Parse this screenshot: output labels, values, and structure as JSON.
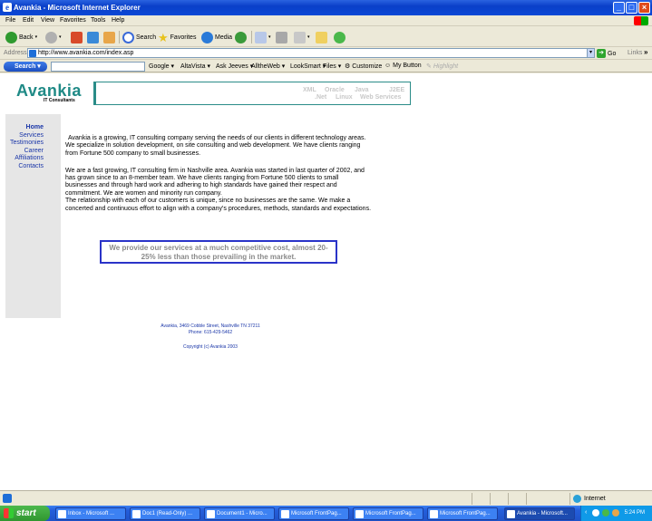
{
  "window": {
    "title": "Avankia - Microsoft Internet Explorer"
  },
  "menu": [
    "File",
    "Edit",
    "View",
    "Favorites",
    "Tools",
    "Help"
  ],
  "toolbar": {
    "back": "Back",
    "search": "Search",
    "favorites": "Favorites",
    "media": "Media"
  },
  "address": {
    "label": "Address",
    "url": "http://www.avankia.com/index.asp",
    "go": "Go",
    "links": "Links"
  },
  "searchbar": {
    "logo": "Search",
    "items": [
      "Google",
      "AltaVista",
      "Ask Jeeves",
      "AlltheWeb",
      "LookSmart",
      "Files",
      "Customize",
      "My Button",
      "Highlight"
    ]
  },
  "site": {
    "logo_title": "Avankia",
    "logo_sub": "IT Consultants",
    "tech": {
      "xml": "XML",
      "oracle": "Oracle",
      "java": "Java",
      "j2ee": "J2EE",
      "net": ".Net",
      "linux": "Linux",
      "web_services": "Web Services"
    },
    "nav": [
      "Home",
      "Services",
      "Testimonies",
      "Career",
      "Affiliations",
      "Contacts"
    ],
    "paragraphs": [
      [
        "Avankia is a growing, IT consulting company serving the needs of our clients in different technology areas.",
        "We specialize in solution development, on site consulting and web development. We have clients ranging",
        "from Fortune 500 company to small businesses."
      ],
      [
        "We are a fast growing, IT consulting firm in Nashville area. Avankia was started in last quarter of 2002, and",
        "has grown since to an 8-member team. We have clients ranging from Fortune 500 clients to small",
        "businesses and through hard work and adhering to high standards have gained their respect and",
        "commitment. We are women and minority run company.",
        "The relationship with each of our customers is unique, since no businesses are the same. We make a",
        "concerted and continuous effort to align with a company's procedures, methods, standards and expectations."
      ]
    ],
    "promo": [
      "We provide our services at a much competitive cost, almost 20-",
      "25% less than those prevailing in the market."
    ],
    "footer": {
      "address": "Avankia, 3469 Cobble Street, Nashville TN 37211",
      "phone": "Phone: 615-429-5462",
      "copyright": "Copyright (c) Avankia 2003"
    }
  },
  "status": {
    "zone": "Internet"
  },
  "taskbar": {
    "start": "start",
    "tasks": [
      "Inbox - Microsoft ...",
      "Doc1 (Read-Only) ...",
      "Document1 - Micro...",
      "Microsoft FrontPag...",
      "Microsoft FrontPag...",
      "Microsoft FrontPag...",
      "Avankia - Microsoft..."
    ],
    "clock": "5:24 PM"
  }
}
